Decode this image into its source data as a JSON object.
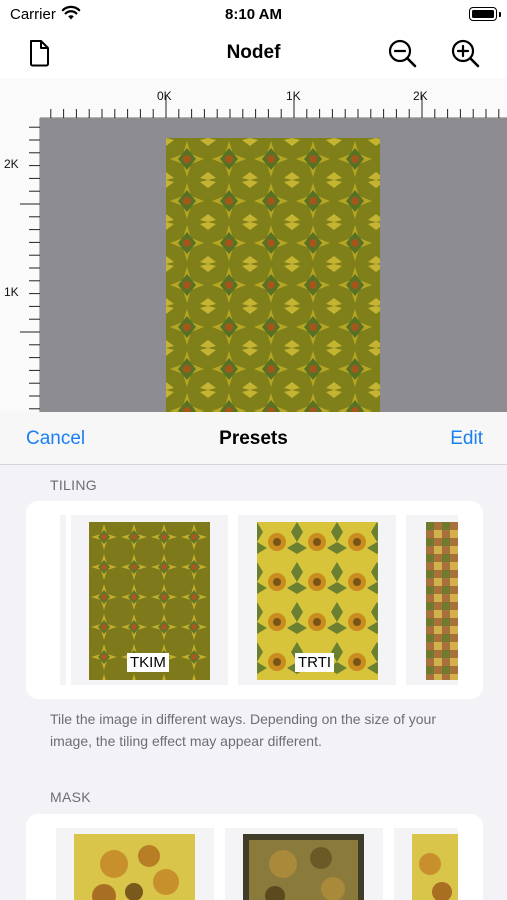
{
  "status": {
    "carrier": "Carrier",
    "time": "8:10 AM"
  },
  "nav": {
    "title": "Nodef",
    "icons": [
      "document-icon",
      "zoom-out-icon",
      "zoom-in-icon"
    ]
  },
  "ruler": {
    "top_labels": [
      "0K",
      "1K",
      "2K"
    ],
    "left_labels": [
      "2K",
      "1K"
    ]
  },
  "sheet": {
    "cancel": "Cancel",
    "title": "Presets",
    "edit": "Edit",
    "tiling": {
      "header": "TILING",
      "items": [
        {
          "label": "TKIM"
        },
        {
          "label": "TRTI"
        }
      ],
      "description": "Tile the image in different ways. Depending on the size of your image, the tiling effect may appear different."
    },
    "mask": {
      "header": "MASK"
    }
  },
  "colors": {
    "accent": "#1a7ff0",
    "canvas_bg": "#8d8d91",
    "sheet_bg": "#f2f2f7"
  }
}
